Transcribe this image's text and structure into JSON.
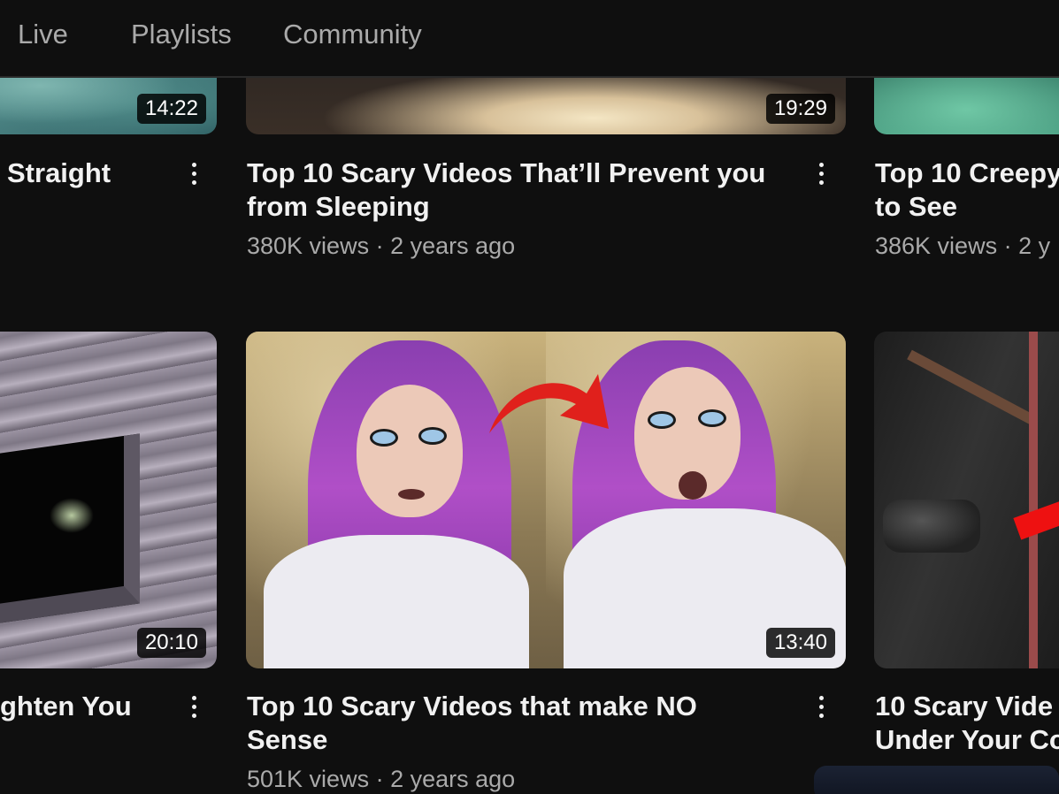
{
  "tabs": [
    "Live",
    "Playlists",
    "Community"
  ],
  "videos": [
    {
      "title_lines": [
        "Straight"
      ],
      "meta": "",
      "duration": "14:22"
    },
    {
      "title_lines": [
        "Top 10 Scary Videos That’ll Prevent you",
        "from Sleeping"
      ],
      "meta": "380K views · 2 years ago",
      "duration": "19:29"
    },
    {
      "title_lines": [
        "Top 10 Creepy",
        "to See"
      ],
      "meta": "386K views · 2 y",
      "duration": ""
    },
    {
      "title_lines": [
        "ghten You"
      ],
      "meta": "",
      "duration": "20:10"
    },
    {
      "title_lines": [
        "Top 10 Scary Videos that make NO",
        "Sense"
      ],
      "meta": "501K views · 2 years ago",
      "duration": "13:40"
    },
    {
      "title_lines": [
        "10 Scary Vide",
        "Under Your Co"
      ],
      "meta": "",
      "duration": ""
    }
  ],
  "icons": {
    "more": "more-vertical-icon"
  },
  "colors": {
    "background": "#0f0f0f",
    "text": "#f1f1f1",
    "secondary_text": "#aaaaaa",
    "arrow": "#e0201c"
  }
}
